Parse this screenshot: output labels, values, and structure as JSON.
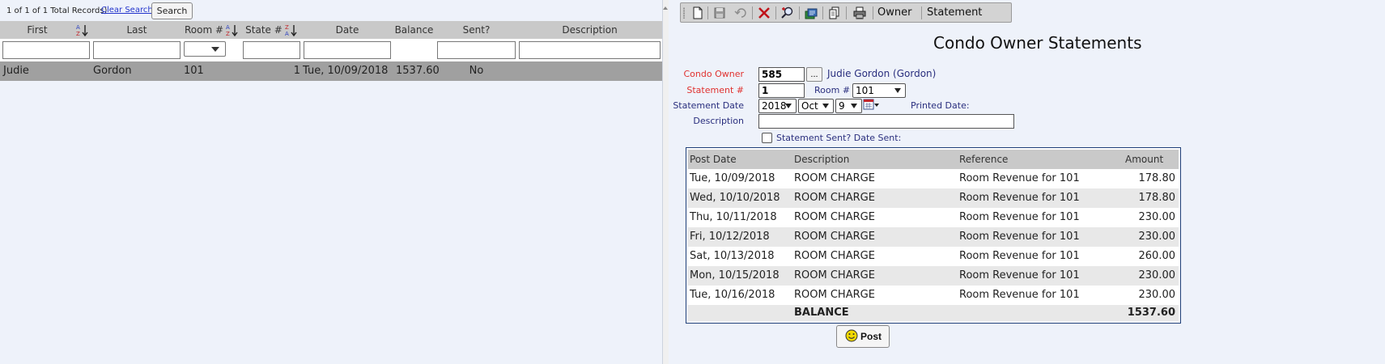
{
  "left": {
    "record_count": "1 of 1 of 1 Total Records)",
    "clear_search": "Clear Search",
    "search_button": "Search",
    "columns": [
      "First",
      "Last",
      "Room #",
      "State #",
      "Date",
      "Balance",
      "Sent?",
      "Description"
    ],
    "row": {
      "first": "Judie",
      "last": "Gordon",
      "room": "101",
      "state": "1",
      "date": "Tue, 10/09/2018",
      "balance": "1537.60",
      "sent": "No",
      "description": ""
    }
  },
  "toolbar": {
    "owner_label": "Owner",
    "statement_label": "Statement",
    "icons": [
      "new-doc-icon",
      "save-icon",
      "undo-icon",
      "delete-icon",
      "find-icon",
      "print-statements-icon",
      "copy-icon",
      "print-icon"
    ]
  },
  "form": {
    "title": "Condo Owner Statements",
    "owner_label": "Condo Owner",
    "owner_value": "585",
    "owner_picker": "...",
    "owner_name": "Judie Gordon (Gordon)",
    "statement_label": "Statement #",
    "statement_value": "1",
    "room_label": "Room #",
    "room_value": "101",
    "date_label": "Statement Date",
    "date_year": "2018",
    "date_month": "Oct",
    "date_day": "9",
    "printed_label": "Printed Date:",
    "description_label": "Description",
    "description_value": "",
    "sent_label": "Statement Sent? Date Sent:"
  },
  "statement": {
    "headers": [
      "Post Date",
      "Description",
      "Reference",
      "Amount"
    ],
    "rows": [
      [
        "Tue, 10/09/2018",
        "ROOM CHARGE",
        "Room Revenue for 101",
        "178.80"
      ],
      [
        "Wed, 10/10/2018",
        "ROOM CHARGE",
        "Room Revenue for 101",
        "178.80"
      ],
      [
        "Thu, 10/11/2018",
        "ROOM CHARGE",
        "Room Revenue for 101",
        "230.00"
      ],
      [
        "Fri, 10/12/2018",
        "ROOM CHARGE",
        "Room Revenue for 101",
        "230.00"
      ],
      [
        "Sat, 10/13/2018",
        "ROOM CHARGE",
        "Room Revenue for 101",
        "260.00"
      ],
      [
        "Mon, 10/15/2018",
        "ROOM CHARGE",
        "Room Revenue for 101",
        "230.00"
      ],
      [
        "Tue, 10/16/2018",
        "ROOM CHARGE",
        "Room Revenue for 101",
        "230.00"
      ]
    ],
    "balance_label": "BALANCE",
    "balance_value": "1537.60"
  },
  "post_button": "Post",
  "colors": {
    "pane_background": "#eef2fa",
    "header_gray": "#c9c9c9",
    "selected_row": "#a0a0a0",
    "required_label": "#e0312f",
    "label_blue": "#2a2f7e",
    "table_border": "#1f3f78"
  }
}
